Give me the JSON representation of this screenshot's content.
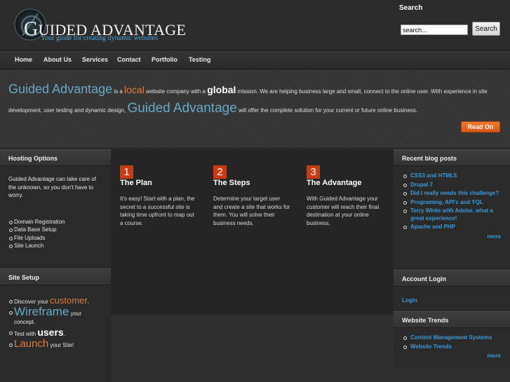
{
  "header": {
    "logo_title_initial": "G",
    "logo_title_rest": "UIDED ADVANTAGE",
    "logo_tagline": "Your guide for creating dynamic websites",
    "search_label": "Search",
    "search_value": "search...",
    "search_button": "Search"
  },
  "nav": [
    "Home",
    "About Us",
    "Services",
    "Contact",
    "Portfolio",
    "Testing"
  ],
  "hero": {
    "brand": "Guided Advantage",
    "t1": " is a ",
    "local": "local",
    "t2": " website company with a ",
    "global": "global",
    "t3": " mission. We are helping business large and small, connect to the online user. With experience in site development, user testing and dynamic design, ",
    "brand2": "Guided Advantage",
    "t4": " will offer the complete solution for your current or future online business.",
    "read_on": "Read On"
  },
  "hosting": {
    "title": "Hosting Options",
    "intro": "Guided Advantage can take care of the unknown, so you don't have to worry.",
    "items": [
      "Domain Registration",
      "Data Base Setup",
      "File Uploads",
      "Site Launch"
    ]
  },
  "site_setup": {
    "title": "Site Setup",
    "discover_pre": "Discover your ",
    "discover_word": "customer.",
    "wireframe_word": "Wireframe",
    "wireframe_post": " your concept.",
    "test_pre": "Test with ",
    "test_word": "users",
    "test_post": ".",
    "launch_word": "Launch",
    "launch_post": " your Site!"
  },
  "features": [
    {
      "num": "1",
      "title": "The Plan",
      "text": "It's easy! Start with a plan, the secret to a successful site is taking time upfront to map out a course."
    },
    {
      "num": "2",
      "title": "The Steps",
      "text": "Determine your target user and create a site that works for them. You will solve their business needs."
    },
    {
      "num": "3",
      "title": "The Advantage",
      "text": "With Guided Advantage your customer will reach their final destination at your online business."
    }
  ],
  "blog": {
    "title": "Recent blog posts",
    "items": [
      "CSS3 and HTML5",
      "Drupal 7",
      "Did I really needs this challenge?",
      "Programing, API's and YQL",
      "Terry White with Adobe, what a great experience!",
      "Apache and PHP"
    ],
    "more": "more"
  },
  "account": {
    "title": "Account Login",
    "login": "Login"
  },
  "trends": {
    "title": "Website Trends",
    "items": [
      "Content Management Systems",
      "Website Trends"
    ],
    "more": "more"
  },
  "colors": {
    "accent_orange": "#e07a3c",
    "accent_blue": "#66a9c7",
    "link_blue": "#3a9ad9",
    "feature_number_red": "#cc3a12"
  }
}
